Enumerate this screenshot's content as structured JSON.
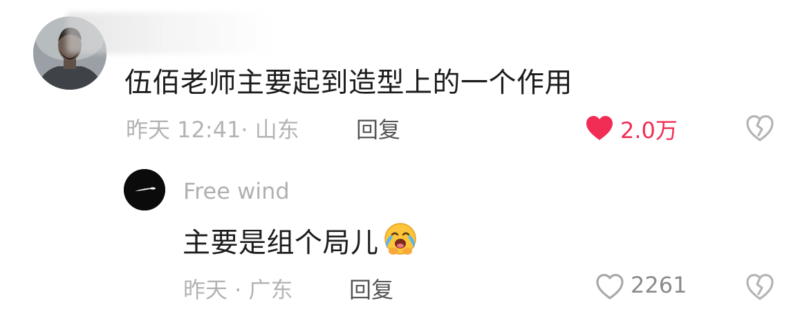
{
  "comment": {
    "username": "",
    "text": "伍佰老师主要起到造型上的一个作用",
    "time_location": "昨天 12:41· 山东",
    "reply_label": "回复",
    "like_count": "2.0万",
    "liked": true,
    "accent_color": "#f12d55",
    "icons": {
      "like": "heart-filled-icon",
      "dislike": "broken-heart-icon"
    }
  },
  "reply": {
    "username": "Free wind",
    "text": "主要是组个局儿",
    "emoji": "crying-face-emoji",
    "time_location": "昨天 · 广东",
    "reply_label": "回复",
    "like_count": "2261",
    "liked": false,
    "icons": {
      "like": "heart-outline-icon",
      "dislike": "broken-heart-icon"
    }
  }
}
